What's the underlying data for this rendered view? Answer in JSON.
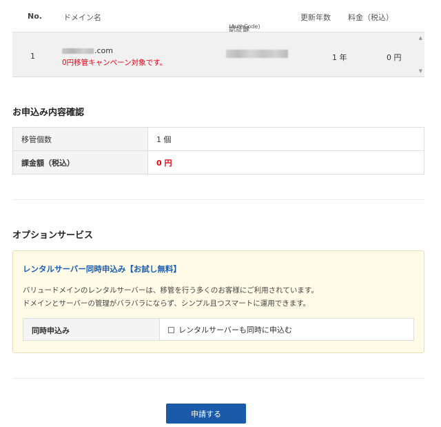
{
  "domain_table": {
    "headers": {
      "no": "No.",
      "domain": "ドメイン名",
      "auth_main": "認証鍵",
      "auth_sub": "(AuthCode)",
      "years": "更新年数",
      "fee": "料金（税込）"
    },
    "row": {
      "no": "1",
      "domain_suffix": ".com",
      "campaign": "0円移管キャンペーン対象です。",
      "years": "1 年",
      "fee": "0 円"
    }
  },
  "confirm": {
    "title": "お申込み内容確認",
    "rows": [
      {
        "label": "移管個数",
        "value": "1 個"
      },
      {
        "label": "課金額（税込）",
        "value": "0 円"
      }
    ]
  },
  "options": {
    "title": "オプションサービス",
    "box_title": "レンタルサーバー同時申込み【お試し無料】",
    "desc_line1": "バリュードメインのレンタルサーバーは、移管を行う多くのお客様にご利用されています。",
    "desc_line2": "ドメインとサーバーの管理がバラバラにならず、シンプル且つスマートに運用できます。",
    "row_label": "同時申込み",
    "checkbox_label": "レンタルサーバーも同時に申込む"
  },
  "submit_label": "申請する",
  "colors": {
    "accent": "#1a5aa8",
    "link": "#1a5fb4",
    "alert": "#e60012",
    "option_bg": "#fffbe6"
  }
}
